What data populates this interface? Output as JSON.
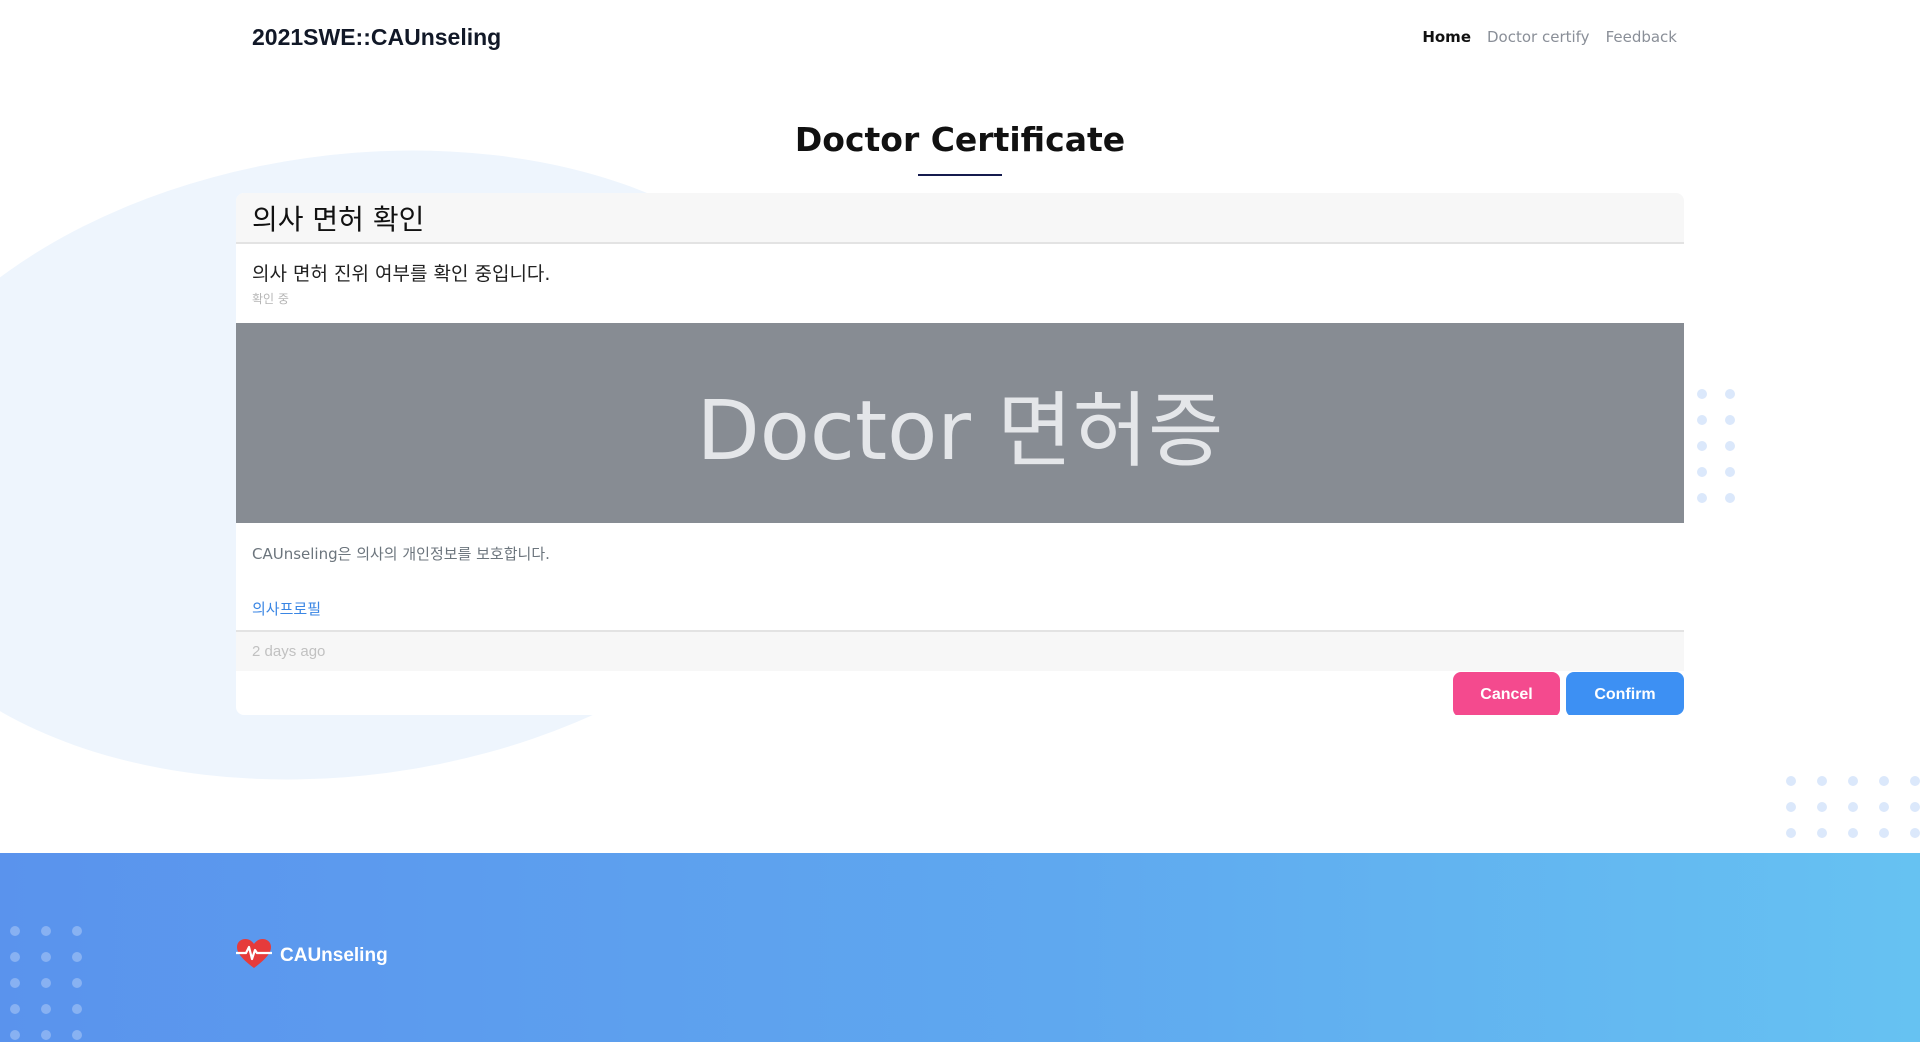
{
  "header": {
    "brand": "2021SWE::CAUnseling",
    "nav": [
      {
        "label": "Home",
        "active": true
      },
      {
        "label": "Doctor certify",
        "active": false
      },
      {
        "label": "Feedback",
        "active": false
      }
    ]
  },
  "page": {
    "title": "Doctor Certificate"
  },
  "card": {
    "header_title": "의사 면허 확인",
    "text": "의사 면허 진위 여부를 확인 중입니다.",
    "subtext": "확인 중",
    "license_image_text": "Doctor 면허증",
    "privacy_text": "CAUnseling은 의사의 개인정보를 보호합니다.",
    "profile_link": "의사프로필",
    "timestamp": "2 days ago",
    "cancel_label": "Cancel",
    "confirm_label": "Confirm"
  },
  "footer": {
    "logo_icon": "heart-pulse-icon",
    "logo_text": "CAUnseling"
  },
  "colors": {
    "cancel": "#f44a8e",
    "confirm": "#3d90f3",
    "footer_start": "#5a93ed",
    "footer_end": "#66c2f2",
    "banner": "#878c93"
  }
}
